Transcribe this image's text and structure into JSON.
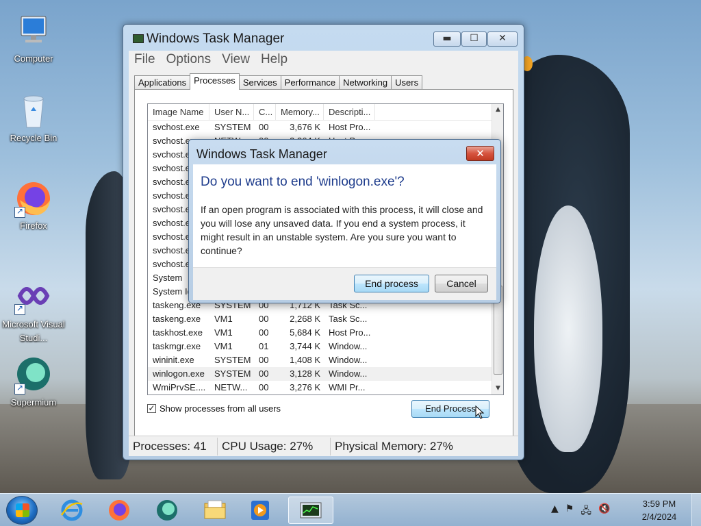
{
  "desktop": {
    "icons": [
      {
        "label": "Computer",
        "icon": "computer-icon"
      },
      {
        "label": "Recycle Bin",
        "icon": "recycle-bin-icon"
      },
      {
        "label": "Firefox",
        "icon": "firefox-icon"
      },
      {
        "label": "Microsoft Visual Studi...",
        "icon": "visual-studio-icon"
      },
      {
        "label": "Supermium",
        "icon": "supermium-icon"
      }
    ]
  },
  "task_manager": {
    "title": "Windows Task Manager",
    "menu": [
      "File",
      "Options",
      "View",
      "Help"
    ],
    "tabs": [
      "Applications",
      "Processes",
      "Services",
      "Performance",
      "Networking",
      "Users"
    ],
    "active_tab": "Processes",
    "columns": [
      "Image Name",
      "User N...",
      "C...",
      "Memory...",
      "Descripti..."
    ],
    "rows": [
      [
        "svchost.exe",
        "SYSTEM",
        "00",
        "3,676 K",
        "Host Pro..."
      ],
      [
        "svchost.exe",
        "NETW...",
        "00",
        "3,364 K",
        "Host Pro..."
      ],
      [
        "svchost.exe",
        "",
        "",
        "",
        ""
      ],
      [
        "svchost.exe",
        "",
        "",
        "",
        ""
      ],
      [
        "svchost.exe",
        "",
        "",
        "",
        ""
      ],
      [
        "svchost.exe",
        "",
        "",
        "",
        ""
      ],
      [
        "svchost.exe",
        "",
        "",
        "",
        ""
      ],
      [
        "svchost.exe",
        "",
        "",
        "",
        ""
      ],
      [
        "svchost.exe",
        "",
        "",
        "",
        ""
      ],
      [
        "svchost.exe",
        "",
        "",
        "",
        ""
      ],
      [
        "svchost.exe",
        "",
        "",
        "",
        ""
      ],
      [
        "System",
        "",
        "",
        "",
        ""
      ],
      [
        "System Idle Process",
        "",
        "",
        "",
        ""
      ],
      [
        "taskeng.exe",
        "SYSTEM",
        "00",
        "1,712 K",
        "Task Sc..."
      ],
      [
        "taskeng.exe",
        "VM1",
        "00",
        "2,268 K",
        "Task Sc..."
      ],
      [
        "taskhost.exe",
        "VM1",
        "00",
        "5,684 K",
        "Host Pro..."
      ],
      [
        "taskmgr.exe",
        "VM1",
        "01",
        "3,744 K",
        "Window..."
      ],
      [
        "wininit.exe",
        "SYSTEM",
        "00",
        "1,408 K",
        "Window..."
      ],
      [
        "winlogon.exe",
        "SYSTEM",
        "00",
        "3,128 K",
        "Window..."
      ],
      [
        "WmiPrvSE....",
        "NETW...",
        "00",
        "3,276 K",
        "WMI Pr..."
      ]
    ],
    "selected_row": 18,
    "show_all_users_label": "Show processes from all users",
    "show_all_users_checked": true,
    "end_process_label": "End Process",
    "status": {
      "processes": "Processes: 41",
      "cpu": "CPU Usage: 27%",
      "memory": "Physical Memory: 27%"
    }
  },
  "dialog": {
    "title": "Windows Task Manager",
    "heading": "Do you want to end 'winlogon.exe'?",
    "message": "If an open program is associated with this process, it will close and you will lose any unsaved data. If you end a system process, it might result in an unstable system. Are you sure you want to continue?",
    "confirm_label": "End process",
    "cancel_label": "Cancel"
  },
  "taskbar": {
    "apps": [
      "internet-explorer-icon",
      "firefox-icon",
      "supermium-icon",
      "file-explorer-icon",
      "media-player-icon",
      "task-manager-icon"
    ],
    "clock_time": "3:59 PM",
    "clock_date": "2/4/2024"
  },
  "colors": {
    "dialog_heading": "#1e3c8c",
    "close_button_red": "#c13a22",
    "taskbar": "#96b9dc"
  }
}
